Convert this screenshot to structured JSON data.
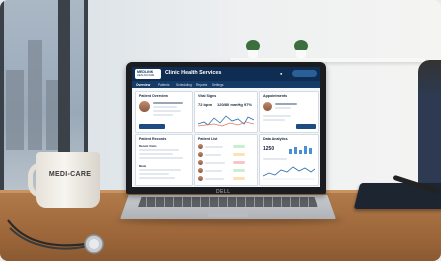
{
  "mug": {
    "text": "MEDI-CARE"
  },
  "laptop": {
    "brand": "DELL"
  },
  "dashboard": {
    "logo": {
      "main": "MEDLINK",
      "sub": "HEALTHCARE"
    },
    "title": "Clinic Health Services",
    "nav": [
      "Overview",
      "Patients",
      "Scheduling",
      "Reports",
      "Settings"
    ],
    "patient_overview": {
      "title": "Patient Overview"
    },
    "vital_signs": {
      "title": "Vital Signs",
      "hr": "72 bpm",
      "bp": "120/80 mmHg",
      "spo2": "97%"
    },
    "appointments": {
      "title": "Appointments"
    },
    "patient_records": {
      "title": "Patient Records",
      "recent_visits": "Recent Visits",
      "meds": "Meds"
    },
    "patient_list": {
      "title": "Patient List"
    },
    "data_analytics": {
      "title": "Data Analytics",
      "total": "1250"
    }
  },
  "colors": {
    "header": "#0f2d52",
    "nav": "#163b66",
    "accent": "#1e4c80",
    "desk": "#a46c3e"
  }
}
